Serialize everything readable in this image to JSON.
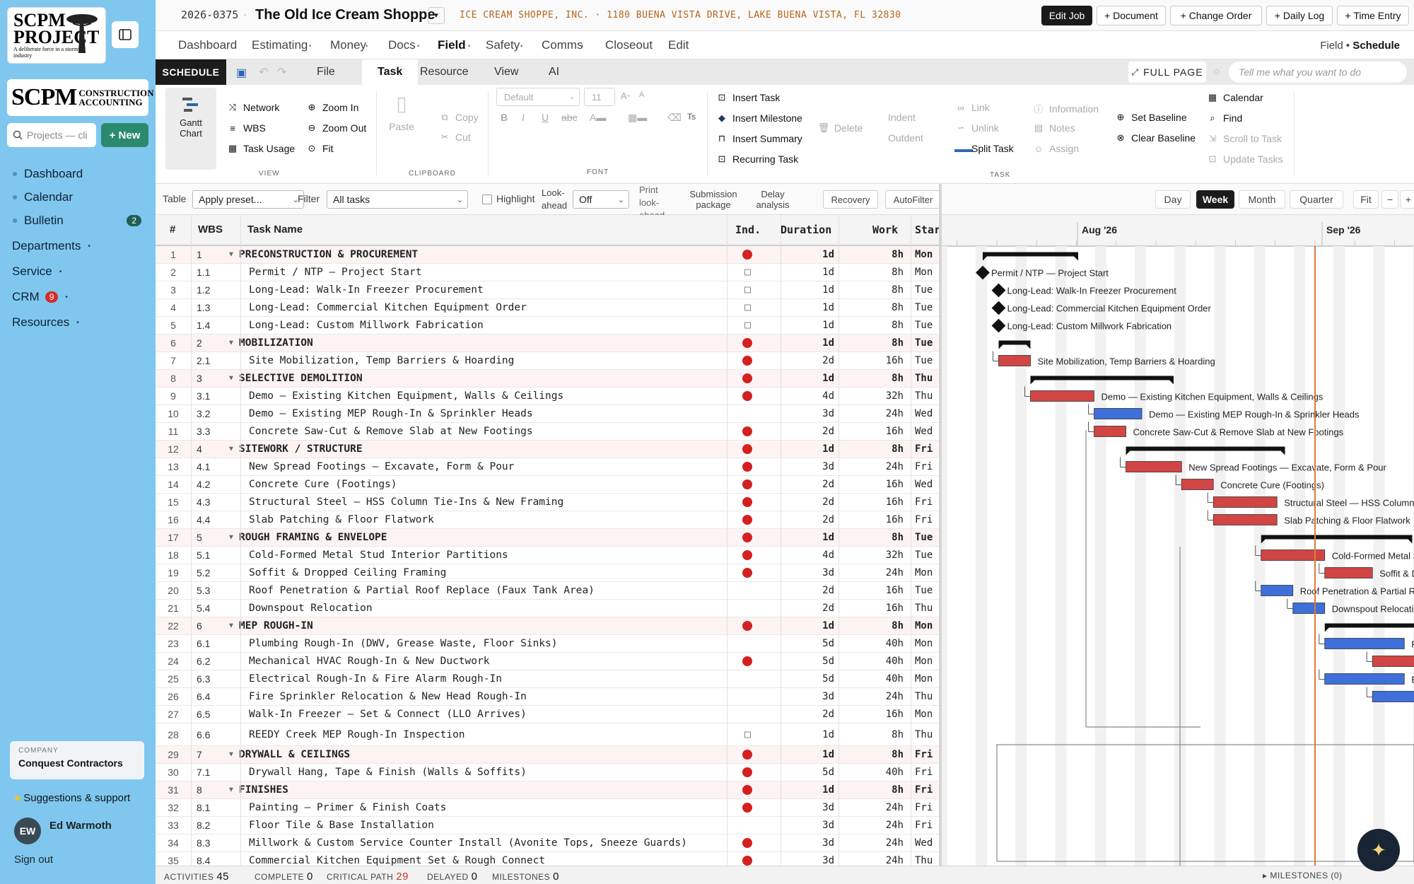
{
  "sidebar": {
    "logo_title": "SCPM PROJECT",
    "logo_tagline": "A deliberate force in a stormy industry",
    "logo2_big": "SCPM",
    "logo2_small_1": "CONSTRUCTION",
    "logo2_small_2": "ACCOUNTING",
    "search_placeholder": "Projects — cli",
    "new_label": "+ New",
    "items": [
      {
        "label": "Dashboard"
      },
      {
        "label": "Calendar"
      },
      {
        "label": "Bulletin",
        "badge": "2"
      },
      {
        "label": "Departments"
      },
      {
        "label": "Service"
      },
      {
        "label": "CRM",
        "badge": "9"
      },
      {
        "label": "Resources"
      }
    ],
    "company_label": "COMPANY",
    "company_value": "Conquest Contractors",
    "suggestions": "Suggestions & support",
    "user_initials": "EW",
    "user_name": "Ed Warmoth",
    "signout": "Sign out"
  },
  "topbar": {
    "job_number": "2026-0375",
    "job_title": "The Old Ice Cream Shoppe",
    "address": "ICE CREAM SHOPPE, INC. · 1180 BUENA VISTA DRIVE, LAKE BUENA VISTA, FL 32830",
    "buttons": [
      "Edit Job",
      "+ Document",
      "+ Change Order",
      "+ Daily Log",
      "+ Time Entry"
    ]
  },
  "menu": {
    "items": [
      "Dashboard",
      "Estimating",
      "Money",
      "Docs",
      "Field",
      "Safety",
      "Comms",
      "Closeout",
      "Edit"
    ],
    "breadcrumb_parent": "Field",
    "breadcrumb_current": "Schedule"
  },
  "ribbon_tabs": {
    "tag": "SCHEDULE",
    "tabs": [
      "File",
      "Task",
      "Resource",
      "View",
      "AI"
    ],
    "full_page": "FULL PAGE",
    "tell_me": "Tell me what you want to do"
  },
  "ribbon": {
    "view": {
      "gantt": "Gantt Chart",
      "network": "Network",
      "wbs": "WBS",
      "task_usage": "Task Usage",
      "zoom_in": "Zoom In",
      "zoom_out": "Zoom Out",
      "fit": "Fit",
      "group": "VIEW"
    },
    "clipboard": {
      "paste": "Paste",
      "copy": "Copy",
      "cut": "Cut",
      "group": "CLIPBOARD"
    },
    "font": {
      "family": "Default",
      "size": "11",
      "group": "FONT"
    },
    "task": {
      "insert_task": "Insert Task",
      "insert_milestone": "Insert Milestone",
      "insert_summary": "Insert Summary",
      "recurring_task": "Recurring Task",
      "delete": "Delete",
      "indent": "Indent",
      "outdent": "Outdent",
      "link": "Link",
      "unlink": "Unlink",
      "split_task": "Split Task",
      "information": "Information",
      "notes": "Notes",
      "assign": "Assign",
      "set_baseline": "Set Baseline",
      "clear_baseline": "Clear Baseline",
      "calendar": "Calendar",
      "find": "Find",
      "scroll_to_task": "Scroll to Task",
      "update_tasks": "Update Tasks",
      "group": "TASK"
    }
  },
  "filters": {
    "table_label": "Table",
    "table_value": "Apply preset...",
    "filter_label": "Filter",
    "filter_value": "All tasks",
    "highlight": "Highlight",
    "lookahead_label": "Look-ahead",
    "lookahead_value": "Off",
    "print_lookahead": "Print look-ahead",
    "submission": "Submission package",
    "delay": "Delay analysis",
    "recovery": "Recovery",
    "autofilter": "AutoFilter"
  },
  "gantt_toolbar": {
    "zoom": [
      "Day",
      "Week",
      "Month",
      "Quarter"
    ],
    "active": "Week",
    "fit": "Fit",
    "minus": "−",
    "plus": "+"
  },
  "gantt_header": {
    "months": [
      "Aug '26",
      "Sep '26"
    ]
  },
  "columns": {
    "num": "#",
    "wbs": "WBS",
    "name": "Task Name",
    "ind": "Ind.",
    "duration": "Duration",
    "work": "Work",
    "start": "Star"
  },
  "tasks": [
    {
      "n": "1",
      "wbs": "1",
      "name": "PRECONSTRUCTION & PROCUREMENT",
      "sum": true,
      "ind": "red",
      "dur": "1d",
      "work": "8h",
      "start": "Mon",
      "bs": 0,
      "be": 6,
      "y": 0
    },
    {
      "n": "2",
      "wbs": "1.1",
      "name": "Permit / NTP — Project Start",
      "ind": "ms",
      "dur": "1d",
      "work": "8h",
      "start": "Mon",
      "ms": true,
      "bs": 0,
      "be": 0
    },
    {
      "n": "3",
      "wbs": "1.2",
      "name": "Long-Lead: Walk-In Freezer Procurement",
      "ind": "ms",
      "dur": "1d",
      "work": "8h",
      "start": "Tue",
      "ms": true,
      "bs": 1,
      "be": 1
    },
    {
      "n": "4",
      "wbs": "1.3",
      "name": "Long-Lead: Commercial Kitchen Equipment Order",
      "ind": "ms",
      "dur": "1d",
      "work": "8h",
      "start": "Tue",
      "ms": true,
      "bs": 1,
      "be": 1
    },
    {
      "n": "5",
      "wbs": "1.4",
      "name": "Long-Lead: Custom Millwork Fabrication",
      "ind": "ms",
      "dur": "1d",
      "work": "8h",
      "start": "Tue",
      "ms": true,
      "bs": 1,
      "be": 1
    },
    {
      "n": "6",
      "wbs": "2",
      "name": "MOBILIZATION",
      "sum": true,
      "ind": "red",
      "dur": "1d",
      "work": "8h",
      "start": "Tue",
      "bs": 1,
      "be": 3
    },
    {
      "n": "7",
      "wbs": "2.1",
      "name": "Site Mobilization, Temp Barriers & Hoarding",
      "ind": "red",
      "dur": "2d",
      "work": "16h",
      "start": "Tue",
      "bs": 1,
      "be": 3,
      "c": "red"
    },
    {
      "n": "8",
      "wbs": "3",
      "name": "SELECTIVE DEMOLITION",
      "sum": true,
      "ind": "red",
      "dur": "1d",
      "work": "8h",
      "start": "Thu",
      "bs": 3,
      "be": 12
    },
    {
      "n": "9",
      "wbs": "3.1",
      "name": "Demo — Existing Kitchen Equipment, Walls & Ceilings",
      "ind": "red",
      "dur": "4d",
      "work": "32h",
      "start": "Thu",
      "bs": 3,
      "be": 7,
      "c": "red"
    },
    {
      "n": "10",
      "wbs": "3.2",
      "name": "Demo — Existing MEP Rough-In & Sprinkler Heads",
      "dur": "3d",
      "work": "24h",
      "start": "Wed",
      "bs": 7,
      "be": 10,
      "c": "blue"
    },
    {
      "n": "11",
      "wbs": "3.3",
      "name": "Concrete Saw-Cut & Remove Slab at New Footings",
      "ind": "red",
      "dur": "2d",
      "work": "16h",
      "start": "Wed",
      "bs": 7,
      "be": 9,
      "c": "red"
    },
    {
      "n": "12",
      "wbs": "4",
      "name": "SITEWORK / STRUCTURE",
      "sum": true,
      "ind": "red",
      "dur": "1d",
      "work": "8h",
      "start": "Fri",
      "bs": 9,
      "be": 19
    },
    {
      "n": "13",
      "wbs": "4.1",
      "name": "New Spread Footings — Excavate, Form & Pour",
      "ind": "red",
      "dur": "3d",
      "work": "24h",
      "start": "Fri",
      "bs": 9,
      "be": 12.5,
      "c": "red"
    },
    {
      "n": "14",
      "wbs": "4.2",
      "name": "Concrete Cure (Footings)",
      "ind": "red",
      "dur": "2d",
      "work": "16h",
      "start": "Wed",
      "bs": 12.5,
      "be": 14.5,
      "c": "red"
    },
    {
      "n": "15",
      "wbs": "4.3",
      "name": "Structural Steel — HSS Column Tie-Ins & New Framing",
      "ind": "red",
      "dur": "2d",
      "work": "16h",
      "start": "Fri",
      "bs": 14.5,
      "be": 18.5,
      "c": "red"
    },
    {
      "n": "16",
      "wbs": "4.4",
      "name": "Slab Patching & Floor Flatwork",
      "ind": "red",
      "dur": "2d",
      "work": "16h",
      "start": "Fri",
      "bs": 14.5,
      "be": 18.5,
      "c": "red"
    },
    {
      "n": "17",
      "wbs": "5",
      "name": "ROUGH FRAMING & ENVELOPE",
      "sum": true,
      "ind": "red",
      "dur": "1d",
      "work": "8h",
      "start": "Tue",
      "bs": 17.5,
      "be": 27
    },
    {
      "n": "18",
      "wbs": "5.1",
      "name": "Cold-Formed Metal Stud Interior Partitions",
      "ind": "red",
      "dur": "4d",
      "work": "32h",
      "start": "Tue",
      "bs": 17.5,
      "be": 21.5,
      "c": "red"
    },
    {
      "n": "19",
      "wbs": "5.2",
      "name": "Soffit & Dropped Ceiling Framing",
      "ind": "red",
      "dur": "3d",
      "work": "24h",
      "start": "Mon",
      "bs": 21.5,
      "be": 24.5,
      "c": "red"
    },
    {
      "n": "20",
      "wbs": "5.3",
      "name": "Roof Penetration & Partial Roof Replace (Faux Tank Area)",
      "dur": "2d",
      "work": "16h",
      "start": "Tue",
      "bs": 17.5,
      "be": 19.5,
      "c": "blue"
    },
    {
      "n": "21",
      "wbs": "5.4",
      "name": "Downspout Relocation",
      "dur": "2d",
      "work": "16h",
      "start": "Thu",
      "bs": 19.5,
      "be": 21.5,
      "c": "blue"
    },
    {
      "n": "22",
      "wbs": "6",
      "name": "MEP ROUGH-IN",
      "sum": true,
      "ind": "red",
      "dur": "1d",
      "work": "8h",
      "start": "Mon",
      "bs": 21.5,
      "be": 33
    },
    {
      "n": "23",
      "wbs": "6.1",
      "name": "Plumbing Rough-In (DWV, Grease Waste, Floor Sinks)",
      "dur": "5d",
      "work": "40h",
      "start": "Mon",
      "bs": 21.5,
      "be": 26.5,
      "c": "blue"
    },
    {
      "n": "24",
      "wbs": "6.2",
      "name": "Mechanical HVAC Rough-In & New Ductwork",
      "ind": "red",
      "dur": "5d",
      "work": "40h",
      "start": "Mon",
      "bs": 24.5,
      "be": 30.5,
      "c": "red"
    },
    {
      "n": "25",
      "wbs": "6.3",
      "name": "Electrical Rough-In & Fire Alarm Rough-In",
      "dur": "5d",
      "work": "40h",
      "start": "Mon",
      "bs": 21.5,
      "be": 26.5,
      "c": "blue"
    },
    {
      "n": "26",
      "wbs": "6.4",
      "name": "Fire Sprinkler Relocation & New Head Rough-In",
      "dur": "3d",
      "work": "24h",
      "start": "Thu",
      "bs": 24.5,
      "be": 29.5,
      "c": "blue"
    },
    {
      "n": "27",
      "wbs": "6.5",
      "name": "Walk-In Freezer — Set & Connect (LLO Arrives)",
      "dur": "2d",
      "work": "16h",
      "start": "Mon",
      "bs": 29.5,
      "be": 31.5,
      "c": "blue"
    },
    {
      "n": "28",
      "wbs": "6.6",
      "name": "REEDY Creek MEP Rough-In Inspection",
      "ind": "ms",
      "dur": "1d",
      "work": "8h",
      "start": "Thu",
      "ms": true,
      "bs": 31.5,
      "be": 31.5,
      "tall": true
    },
    {
      "n": "29",
      "wbs": "7",
      "name": "DRYWALL & CEILINGS",
      "sum": true,
      "ind": "red",
      "dur": "1d",
      "work": "8h",
      "start": "Fri",
      "bs": 32,
      "be": 37
    },
    {
      "n": "30",
      "wbs": "7.1",
      "name": "Drywall Hang, Tape & Finish (Walls & Soffits)",
      "ind": "red",
      "dur": "5d",
      "work": "40h",
      "start": "Fri",
      "bs": 32,
      "be": 37,
      "c": "red"
    },
    {
      "n": "31",
      "wbs": "8",
      "name": "FINISHES",
      "sum": true,
      "ind": "red",
      "dur": "1d",
      "work": "8h",
      "start": "Fri",
      "bs": 37,
      "be": 48
    },
    {
      "n": "32",
      "wbs": "8.1",
      "name": "Painting — Primer & Finish Coats",
      "ind": "red",
      "dur": "3d",
      "work": "24h",
      "start": "Fri",
      "bs": 37,
      "be": 40.5,
      "c": "red"
    },
    {
      "n": "33",
      "wbs": "8.2",
      "name": "Floor Tile & Base Installation",
      "dur": "3d",
      "work": "24h",
      "start": "Fri",
      "bs": 37,
      "be": 40.5,
      "c": "blue"
    },
    {
      "n": "34",
      "wbs": "8.3",
      "name": "Millwork & Custom Service Counter Install (Avonite Tops, Sneeze Guards)",
      "ind": "red",
      "dur": "3d",
      "work": "24h",
      "start": "Wed",
      "bs": 40.5,
      "be": 44,
      "c": "red"
    },
    {
      "n": "35",
      "wbs": "8.4",
      "name": "Commercial Kitchen Equipment Set & Rough Connect",
      "ind": "red",
      "dur": "3d",
      "work": "24h",
      "start": "Thu",
      "bs": 40.5,
      "be": 44,
      "c": "red"
    }
  ],
  "status": {
    "activities_label": "ACTIVITIES",
    "activities": "45",
    "complete_label": "COMPLETE",
    "complete": "0",
    "critical_label": "CRITICAL PATH",
    "critical": "29",
    "delayed_label": "DELAYED",
    "delayed": "0",
    "milestones_label": "MILESTONES",
    "milestones": "0",
    "right_label": "▸ MILESTONES",
    "right_value": "(0)"
  },
  "colors": {
    "critical": "#d14545",
    "normal": "#3f6fd8",
    "summary": "#111111",
    "today": "#e07a3b"
  }
}
